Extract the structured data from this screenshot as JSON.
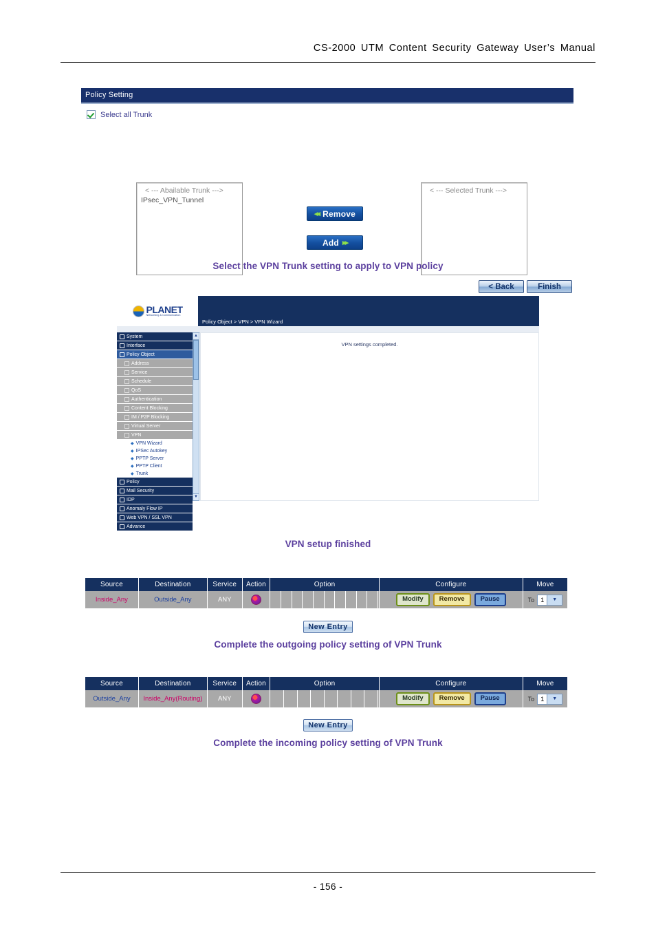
{
  "document": {
    "header": "CS-2000  UTM  Content  Security  Gateway  User’s  Manual",
    "page_number": "- 156 -"
  },
  "policy_setting_panel": {
    "title": "Policy Setting",
    "select_all_label": "Select all Trunk",
    "available_list": {
      "header": "< --- Abailable Trunk --->",
      "items": [
        "IPsec_VPN_Tunnel"
      ]
    },
    "selected_list": {
      "header": "< --- Selected Trunk --->",
      "items": []
    },
    "remove_button": "Remove",
    "add_button": "Add",
    "back_button": "< Back",
    "finish_button": "Finish"
  },
  "captions": {
    "c1": "Select the VPN Trunk setting to apply to VPN policy",
    "c2": "VPN setup finished",
    "c3": "Complete the outgoing policy setting of VPN Trunk",
    "c4": "Complete the incoming policy setting of VPN Trunk"
  },
  "admin_ui": {
    "logo_name": "PLANET",
    "logo_tagline": "Networking & Communication",
    "breadcrumb": "Policy Object > VPN > VPN Wizard",
    "content_message": "VPN settings completed.",
    "scroll_up": "▲",
    "scroll_down": "▼",
    "sidebar": [
      {
        "label": "System",
        "type": "top"
      },
      {
        "label": "Interface",
        "type": "top"
      },
      {
        "label": "Policy Object",
        "type": "top-active"
      },
      {
        "label": "Address",
        "type": "sub"
      },
      {
        "label": "Service",
        "type": "sub"
      },
      {
        "label": "Schedule",
        "type": "sub"
      },
      {
        "label": "QoS",
        "type": "sub"
      },
      {
        "label": "Authentication",
        "type": "sub"
      },
      {
        "label": "Content Blocking",
        "type": "sub"
      },
      {
        "label": "IM / P2P Blocking",
        "type": "sub"
      },
      {
        "label": "Virtual Server",
        "type": "sub"
      },
      {
        "label": "VPN",
        "type": "sub"
      },
      {
        "label": "VPN Wizard",
        "type": "leaf"
      },
      {
        "label": "IPSec Autokey",
        "type": "leaf"
      },
      {
        "label": "PPTP Server",
        "type": "leaf"
      },
      {
        "label": "PPTP Client",
        "type": "leaf"
      },
      {
        "label": "Trunk",
        "type": "leaf"
      },
      {
        "label": "Policy",
        "type": "top"
      },
      {
        "label": "Mail Security",
        "type": "top"
      },
      {
        "label": "IDP",
        "type": "top"
      },
      {
        "label": "Anomaly Flow IP",
        "type": "top"
      },
      {
        "label": "Web VPN / SSL VPN",
        "type": "top"
      },
      {
        "label": "Advance",
        "type": "top"
      }
    ]
  },
  "policy_tables": [
    {
      "name": "outgoing",
      "columns": [
        "Source",
        "Destination",
        "Service",
        "Action",
        "Option",
        "Configure",
        "Move"
      ],
      "row": {
        "source": "Inside_Any",
        "destination": "Outside_Any",
        "service": "ANY",
        "action_icon": "block-icon",
        "option_slots": 10,
        "configure": [
          "Modify",
          "Remove",
          "Pause"
        ],
        "move_label": "To",
        "move_value": "1"
      },
      "new_entry_button": "New  Entry"
    },
    {
      "name": "incoming",
      "columns": [
        "Source",
        "Destination",
        "Service",
        "Action",
        "Option",
        "Configure",
        "Move"
      ],
      "row": {
        "source": "Outside_Any",
        "destination": "Inside_Any(Routing)",
        "service": "ANY",
        "action_icon": "block-icon",
        "option_slots": 8,
        "configure": [
          "Modify",
          "Remove",
          "Pause"
        ],
        "move_label": "To",
        "move_value": "1"
      },
      "new_entry_button": "New  Entry"
    }
  ]
}
